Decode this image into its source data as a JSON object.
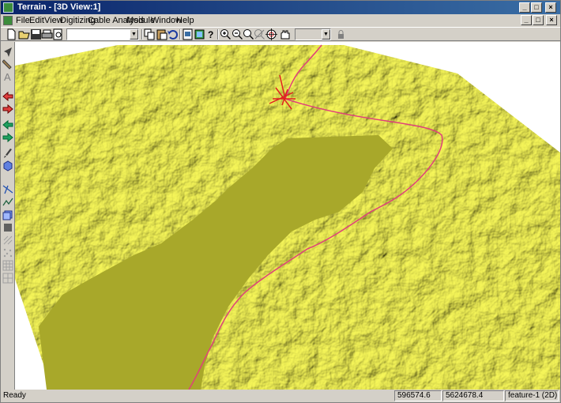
{
  "window": {
    "title": "Terrain - [3D View:1]"
  },
  "menu": [
    "File",
    "Edit",
    "View",
    "Digitizing",
    "Cable Analysis",
    "Module",
    "Window",
    "Help"
  ],
  "toolbar": {
    "layer_combo_value": "",
    "zoom_combo_value": "",
    "icons": [
      "new-icon",
      "open-icon",
      "save-icon",
      "print-icon",
      "print-preview-icon",
      "copy-icon",
      "paste-icon",
      "undo-icon",
      "properties-icon",
      "layers-icon",
      "help-icon",
      "zoom-in-icon",
      "zoom-out-icon",
      "zoom-extent-icon",
      "zoom-window-icon",
      "pan-target-icon",
      "rotate-hand-icon",
      "lock-icon"
    ]
  },
  "toolbox": [
    "select-arrow-icon",
    "pencil-icon",
    "text-icon",
    "arrow-left-red-icon",
    "arrow-right-red-icon",
    "arrow-left-green-icon",
    "arrow-right-green-icon",
    "brush-icon",
    "cube-icon",
    "cable-icon",
    "profile-icon",
    "box-icon",
    "fill-icon",
    "hatch-icon",
    "points-icon",
    "grid-icon",
    "grid2-icon"
  ],
  "colors": {
    "terrain": "#c8c832",
    "lake": "#a8a82a",
    "cable_line": "#e0407a",
    "marker": "#e02020"
  },
  "status": {
    "ready": "Ready",
    "x": "596574.6",
    "y": "5624678.4",
    "feature": "feature-1 (2D)"
  }
}
